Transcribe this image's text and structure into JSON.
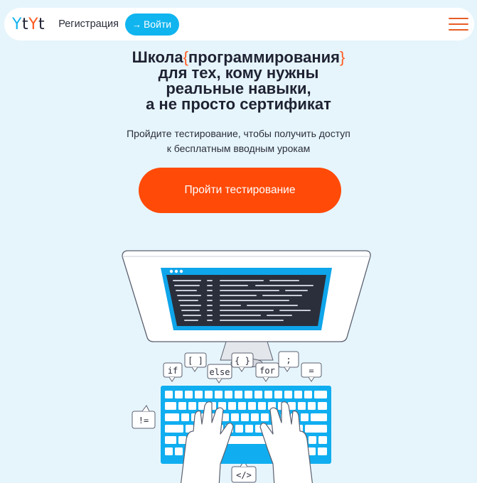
{
  "header": {
    "logo": [
      "Y",
      "t",
      "Y",
      "t"
    ],
    "register_label": "Регистрация",
    "login_label": "Войти",
    "login_arrow": "→"
  },
  "hero": {
    "title_prefix": "Школа",
    "brace_open": "{",
    "title_highlight": "программирования",
    "brace_close": "}",
    "title_line2": "для тех, кому нужны",
    "title_line3": "реальные навыки,",
    "title_line4": "а не просто сертификат",
    "subtitle_line1": "Пройдите тестирование, чтобы получить доступ",
    "subtitle_line2": "к бесплатным вводным урокам",
    "cta_label": "Пройти тестирование"
  },
  "illustration": {
    "bubbles": [
      "if",
      "[ ]",
      "else",
      "{ }",
      "for",
      ";",
      "=",
      "!=",
      "</>"
    ]
  },
  "colors": {
    "background": "#e6f5fc",
    "accent_blue": "#10b4ef",
    "accent_orange": "#ff4a08",
    "text_dark": "#1f2233"
  }
}
